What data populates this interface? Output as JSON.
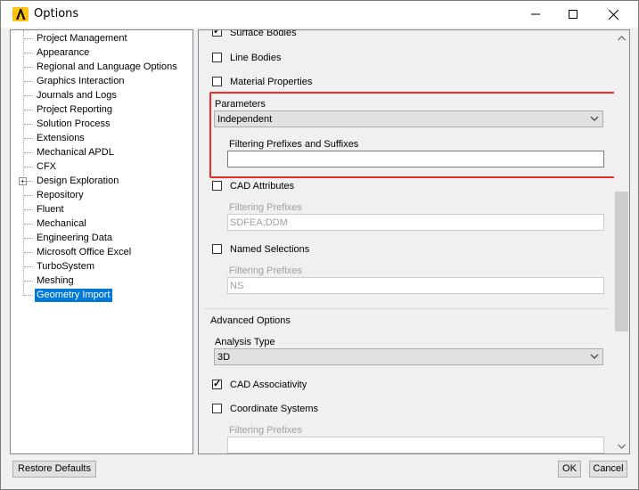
{
  "window": {
    "title": "Options"
  },
  "tree": {
    "items": [
      {
        "label": "Project Management"
      },
      {
        "label": "Appearance"
      },
      {
        "label": "Regional and Language Options"
      },
      {
        "label": "Graphics Interaction"
      },
      {
        "label": "Journals and Logs"
      },
      {
        "label": "Project Reporting"
      },
      {
        "label": "Solution Process"
      },
      {
        "label": "Extensions"
      },
      {
        "label": "Mechanical APDL"
      },
      {
        "label": "CFX"
      },
      {
        "label": "Design Exploration"
      },
      {
        "label": "Repository"
      },
      {
        "label": "Fluent"
      },
      {
        "label": "Mechanical"
      },
      {
        "label": "Engineering Data"
      },
      {
        "label": "Microsoft Office Excel"
      },
      {
        "label": "TurboSystem"
      },
      {
        "label": "Meshing"
      },
      {
        "label": "Geometry Import"
      }
    ],
    "selected": "Geometry Import"
  },
  "panel": {
    "surface_bodies": {
      "label": "Surface Bodies",
      "checked": true
    },
    "line_bodies": {
      "label": "Line Bodies",
      "checked": false
    },
    "material_properties": {
      "label": "Material Properties",
      "checked": false
    },
    "parameters": {
      "label": "Parameters",
      "value": "Independent",
      "filter_label": "Filtering Prefixes and Suffixes",
      "filter_value": ""
    },
    "cad_attributes": {
      "label": "CAD Attributes",
      "checked": false,
      "filter_label": "Filtering Prefixes",
      "filter_value": "SDFEA;DDM"
    },
    "named_selections": {
      "label": "Named Selections",
      "checked": false,
      "filter_label": "Filtering Prefixes",
      "filter_value": "NS"
    },
    "advanced_options": {
      "heading": "Advanced Options",
      "analysis_type_label": "Analysis Type",
      "analysis_type_value": "3D",
      "cad_associativity": {
        "label": "CAD Associativity",
        "checked": true
      },
      "coordinate_systems": {
        "label": "Coordinate Systems",
        "checked": false,
        "filter_label": "Filtering Prefixes",
        "filter_value": ""
      }
    }
  },
  "buttons": {
    "restore": "Restore Defaults",
    "ok": "OK",
    "cancel": "Cancel"
  },
  "colors": {
    "accent": "#0078d7",
    "highlight": "#e8302a",
    "logo": "#ffc20e"
  }
}
